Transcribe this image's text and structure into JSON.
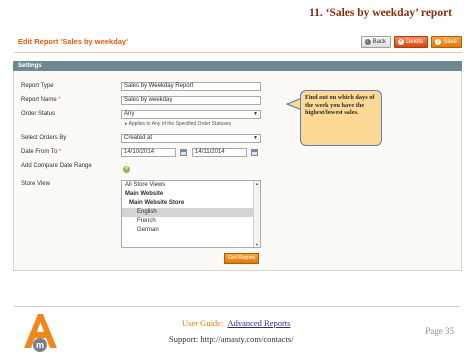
{
  "doc": {
    "title": "11. ‘Sales by weekday’ report",
    "guide_label": "User Guide:",
    "guide_link": "Advanced Reports",
    "support": "Support: http://amasty.com/contacts/",
    "page": "Page 35"
  },
  "header": {
    "title": "Edit Report 'Sales by weekday'",
    "back_label": "Back",
    "delete_label": "Delete",
    "save_label": "Save"
  },
  "panel": {
    "title": "Settings"
  },
  "form": {
    "report_type_label": "Report Type",
    "report_type_value": "Sales by Weekday Report",
    "report_name_label": "Report Name",
    "report_name_value": "Sales by weekday",
    "order_status_label": "Order Status",
    "order_status_value": "Any",
    "order_status_note": "Applies to Any of the Specified Order Statuses",
    "select_orders_label": "Select Orders By",
    "select_orders_value": "Created at",
    "date_label": "Date From To",
    "date_from": "14/10/2014",
    "date_to": "14/11/2014",
    "compare_label": "Add Compare Date Range",
    "store_view_label": "Store View",
    "store_views": [
      "All Store Views",
      "Main Website",
      "Main Website Store",
      "English",
      "French",
      "German"
    ],
    "get_report_label": "Get Report"
  },
  "callout": {
    "text": "Find out on which days of the week you have the highest/lowest sales."
  },
  "colors": {
    "accent": "#e25b0f",
    "panel_header": "#6f8992",
    "callout_bg": "#fdd996"
  }
}
